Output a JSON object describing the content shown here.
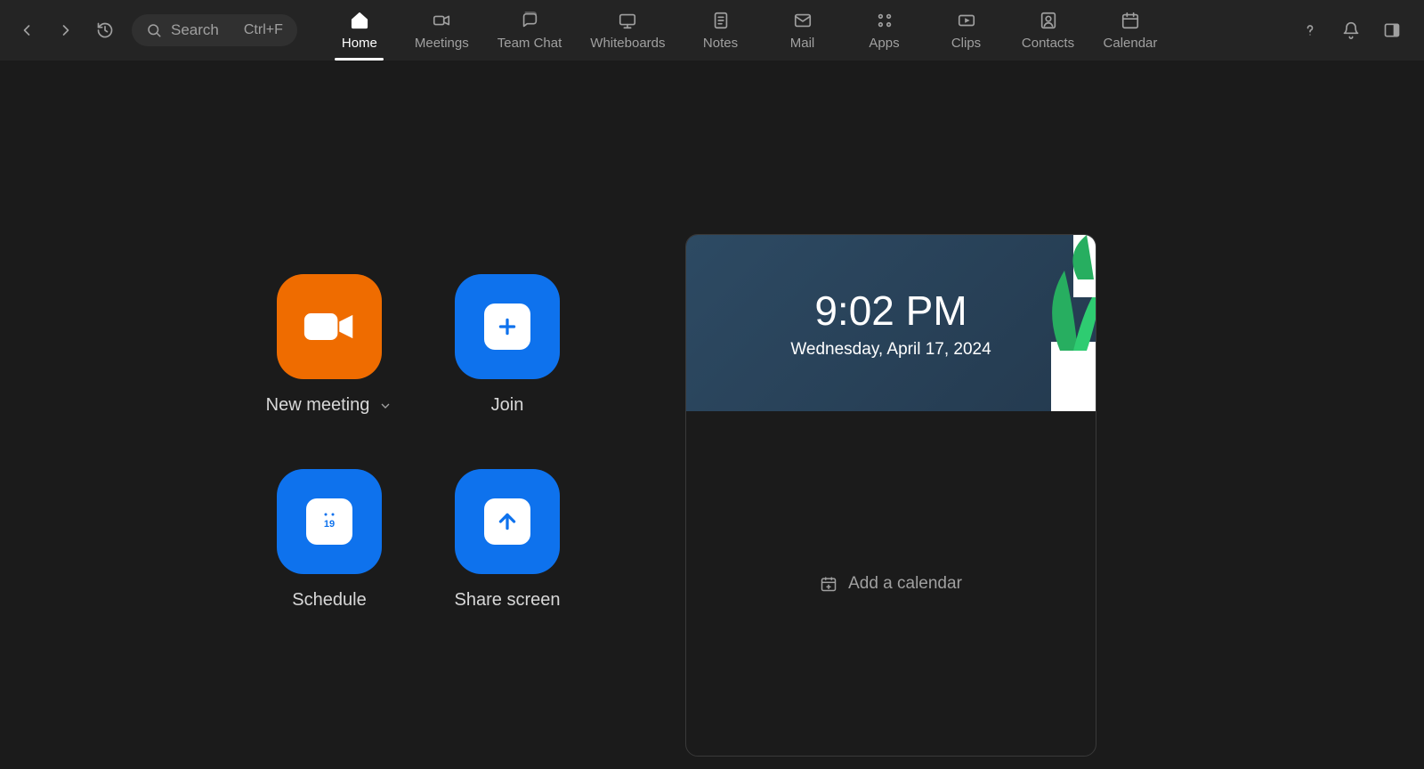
{
  "search": {
    "placeholder": "Search",
    "shortcut": "Ctrl+F"
  },
  "tabs": [
    {
      "label": "Home",
      "icon": "home",
      "active": true
    },
    {
      "label": "Meetings",
      "icon": "video",
      "active": false
    },
    {
      "label": "Team Chat",
      "icon": "chat",
      "active": false
    },
    {
      "label": "Whiteboards",
      "icon": "whiteboard",
      "active": false
    },
    {
      "label": "Notes",
      "icon": "notes",
      "active": false
    },
    {
      "label": "Mail",
      "icon": "mail",
      "active": false
    },
    {
      "label": "Apps",
      "icon": "apps",
      "active": false
    },
    {
      "label": "Clips",
      "icon": "clips",
      "active": false
    },
    {
      "label": "Contacts",
      "icon": "contacts",
      "active": false
    },
    {
      "label": "Calendar",
      "icon": "calendar",
      "active": false
    }
  ],
  "actions": {
    "new_meeting": {
      "label": "New meeting",
      "has_dropdown": true
    },
    "join": {
      "label": "Join"
    },
    "schedule": {
      "label": "Schedule",
      "day": "19"
    },
    "share": {
      "label": "Share screen"
    }
  },
  "clock": {
    "time": "9:02 PM",
    "date": "Wednesday, April 17, 2024"
  },
  "calendar_empty": {
    "label": "Add a calendar"
  }
}
